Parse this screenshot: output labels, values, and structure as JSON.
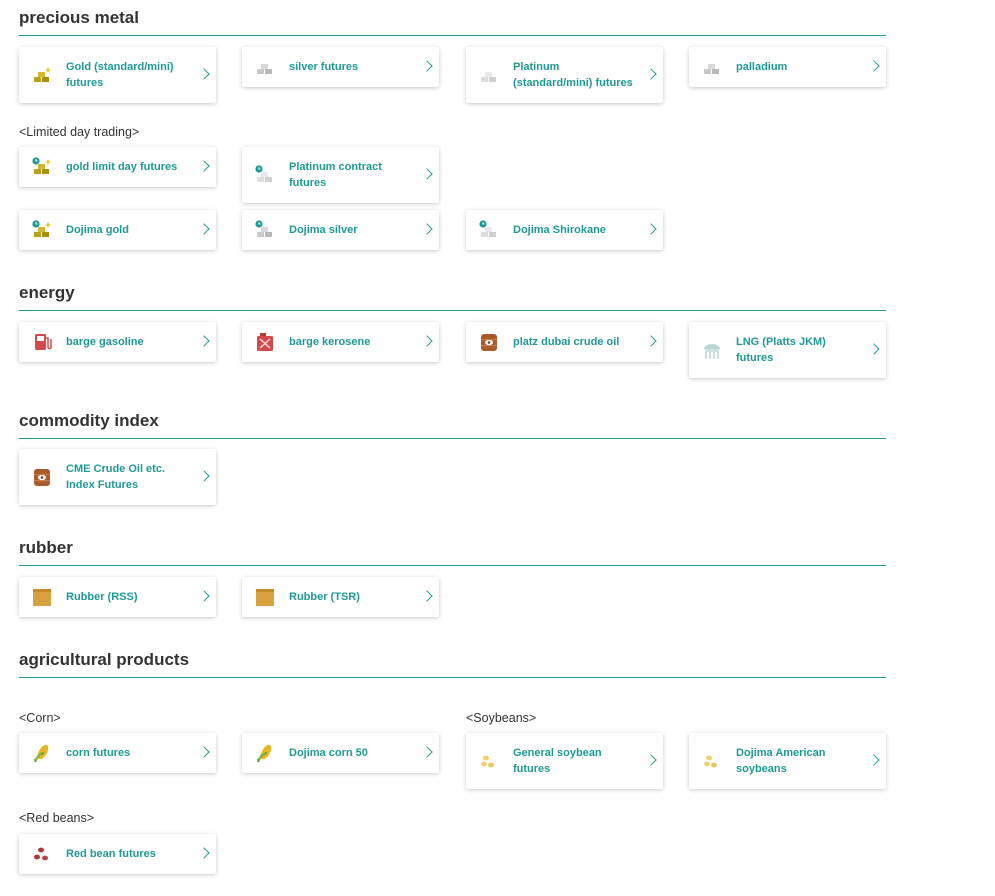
{
  "sections": {
    "precious_metal": "precious metal",
    "energy": "energy",
    "commodity_index": "commodity index",
    "rubber": "rubber",
    "agricultural": "agricultural products"
  },
  "sublabels": {
    "limited_day": "<Limited day trading>",
    "corn": "<Corn>",
    "soybeans": "<Soybeans>",
    "red_beans": "<Red beans>"
  },
  "cards": {
    "gold": "Gold (standard/mini) futures",
    "silver": "silver futures",
    "platinum": "Platinum (standard/mini) futures",
    "palladium": "palladium",
    "gold_limit": "gold limit day futures",
    "platinum_contract": "Platinum contract futures",
    "dojima_gold": "Dojima gold",
    "dojima_silver": "Dojima silver",
    "dojima_shirokane": "Dojima Shirokane",
    "barge_gasoline": "barge gasoline",
    "barge_kerosene": "barge kerosene",
    "platz_dubai": "platz dubai crude oil",
    "lng": "LNG (Platts JKM) futures",
    "cme_crude": "CME Crude Oil etc. Index Futures",
    "rubber_rss": "Rubber (RSS)",
    "rubber_tsr": "Rubber (TSR)",
    "corn_futures": "corn futures",
    "dojima_corn": "Dojima corn 50",
    "general_soybean": "General soybean futures",
    "dojima_american": "Dojima American soybeans",
    "red_bean": "Red bean futures"
  },
  "icons": {
    "gold": "gold-bars-icon",
    "silver": "silver-bars-icon",
    "platinum": "platinum-bars-icon",
    "fuel": "fuel-pump-icon",
    "kerosene": "jerrycan-icon",
    "barrel": "oil-barrel-icon",
    "lng": "lng-tank-icon",
    "rubber": "rubber-box-icon",
    "corn": "corn-icon",
    "soybean": "soybean-icon",
    "redbean": "red-bean-icon"
  },
  "colors": {
    "accent": "#1d9a95",
    "gold": "#b8a020",
    "silver": "#c8c8c8",
    "fuel": "#d44a4a",
    "barrel": "#a85a2a",
    "rubber": "#d9a040"
  }
}
